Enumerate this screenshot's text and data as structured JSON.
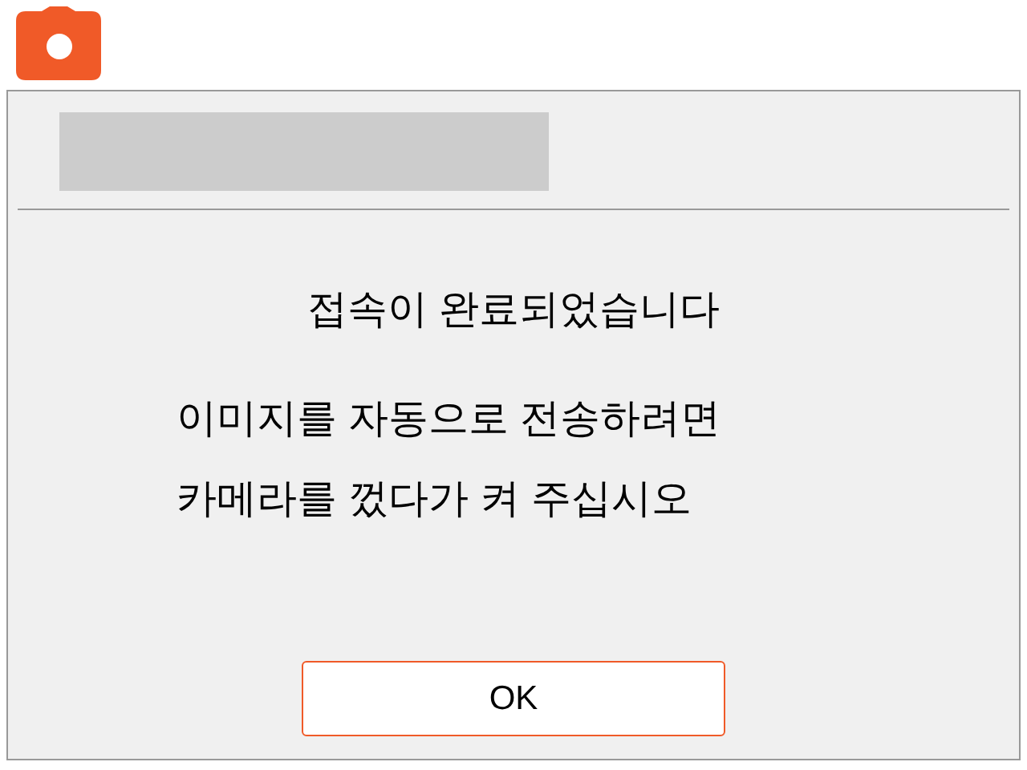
{
  "dialog": {
    "heading": "접속이 완료되었습니다",
    "message_lines": [
      "이미지를 자동으로 전송하려면",
      "카메라를 껐다가 켜 주십시오"
    ],
    "buttons": [
      "OK"
    ]
  }
}
